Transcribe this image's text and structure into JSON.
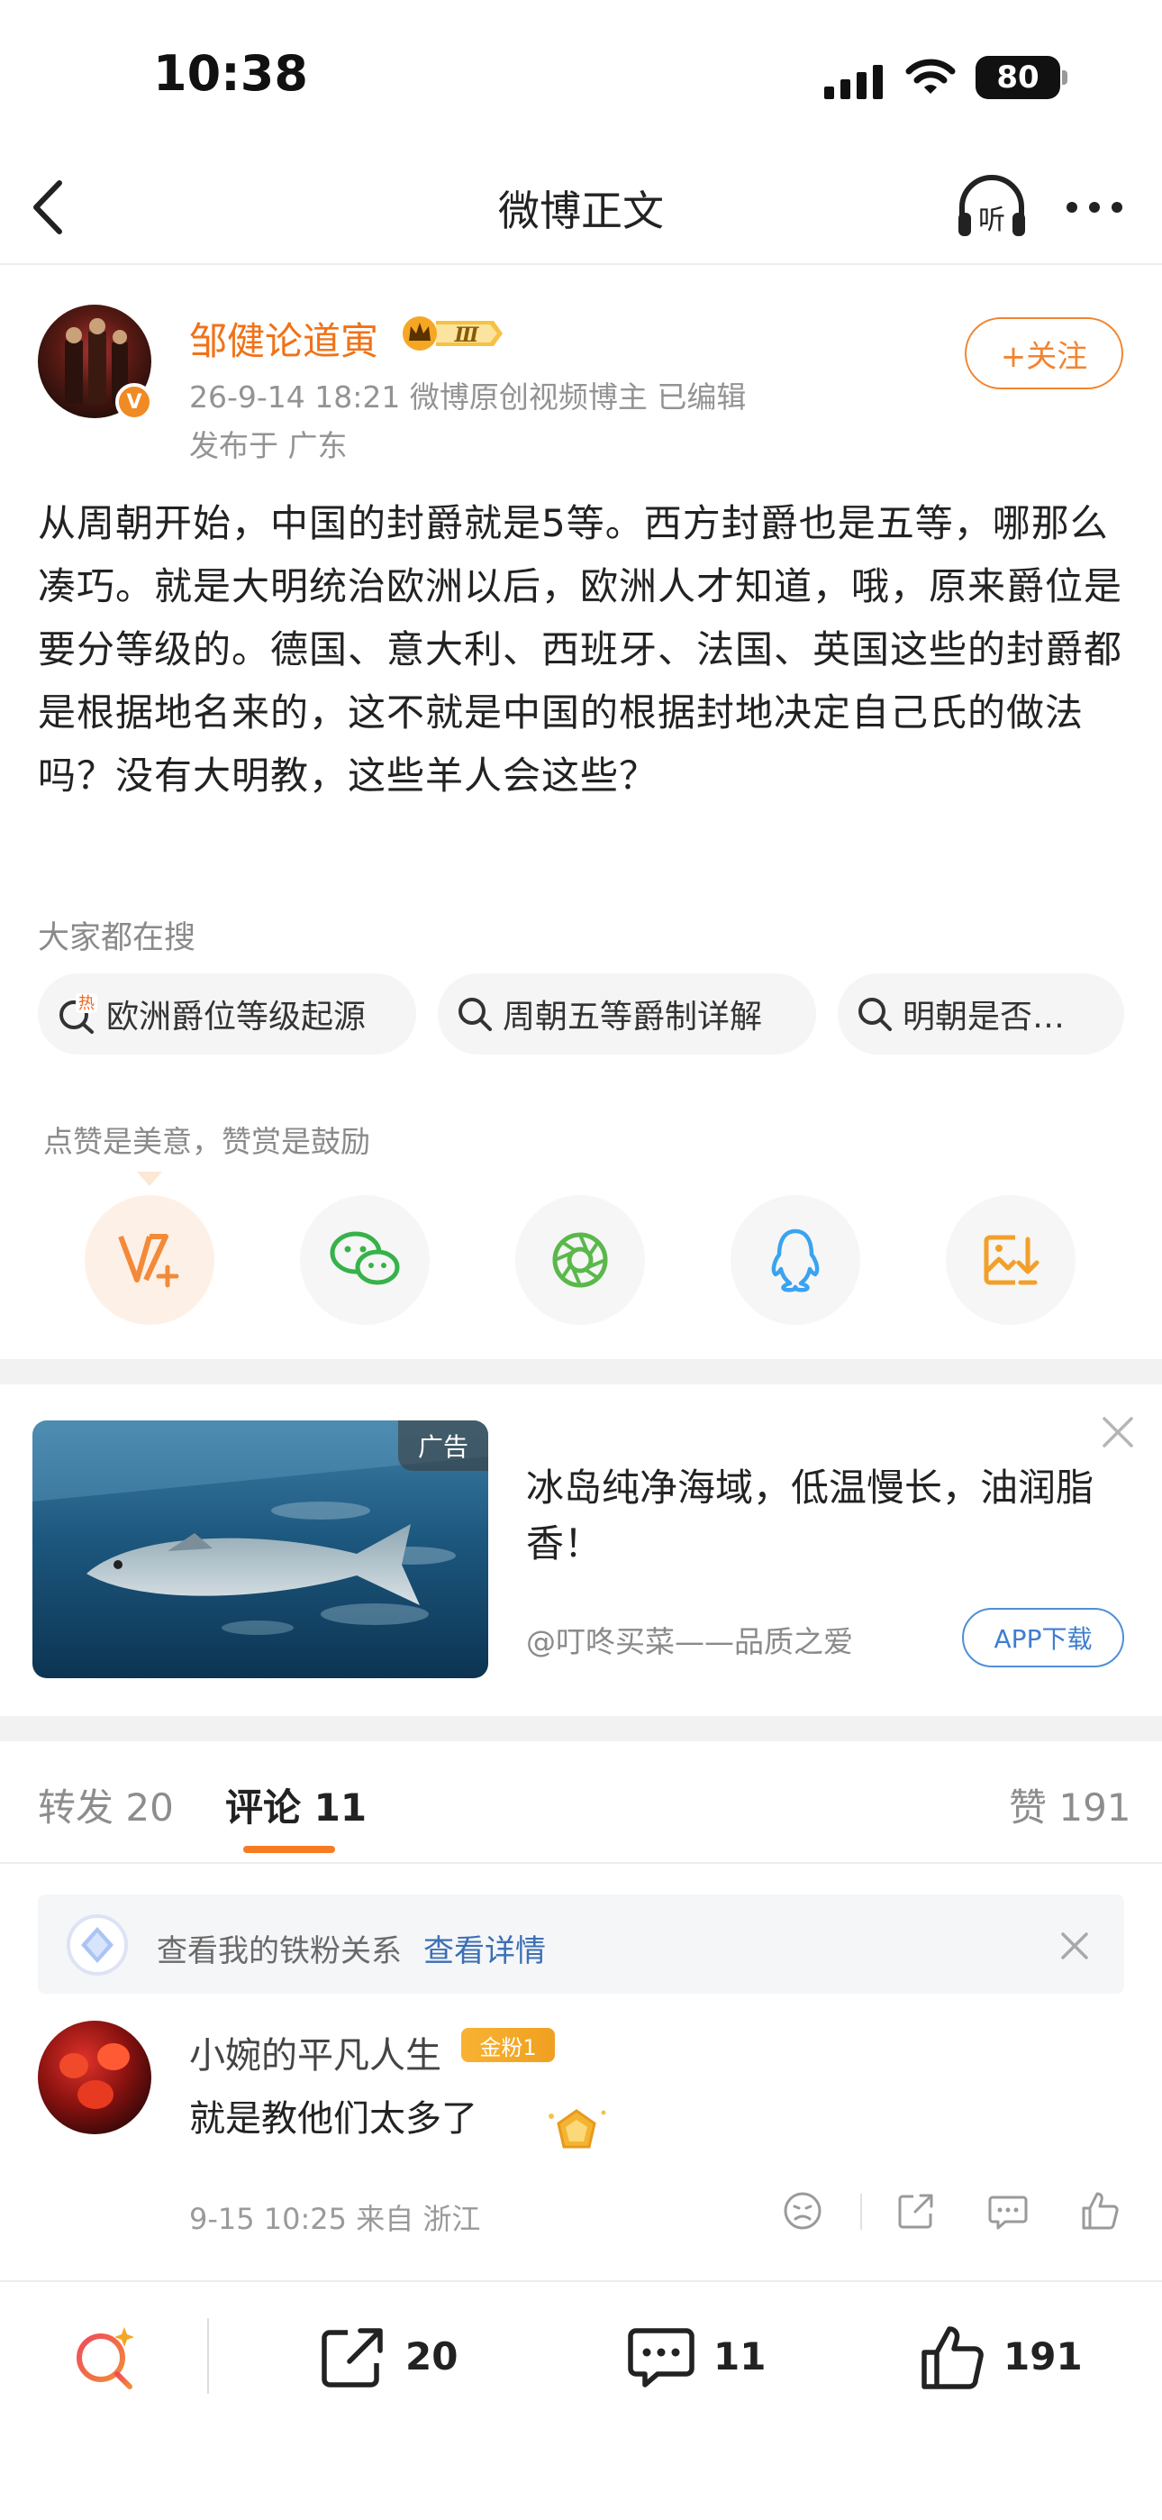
{
  "status_bar": {
    "time": "10:38",
    "battery": "80"
  },
  "nav": {
    "title": "微博正文",
    "listen_icon": "listen-headphones-icon",
    "more_icon": "more-icon"
  },
  "author": {
    "name": "邹健论道寅",
    "vip_icon": "crown-vip-badge-icon",
    "vip_level": "Ⅲ",
    "verified_mark": "V",
    "meta": "26-9-14 18:21  微博原创视频博主  已编辑",
    "location": "发布于 广东",
    "follow_label": "+关注"
  },
  "post": {
    "text": "从周朝开始，中国的封爵就是5等。西方封爵也是五等，哪那么凑巧。就是大明统治欧洲以后，欧洲人才知道，哦，原来爵位是要分等级的。德国、意大利、西班牙、法国、英国这些的封爵都是根据地名来的，这不就是中国的根据封地决定自己氏的做法吗？没有大明教，这些羊人会这些？"
  },
  "search": {
    "title": "大家都在搜",
    "hot_mark": "热",
    "chips": [
      "欧洲爵位等级起源",
      "周朝五等爵制详解",
      "明朝是否…"
    ]
  },
  "reward": {
    "tip": "点赞是美意，赞赏是鼓励"
  },
  "share_buttons": [
    "reward-v-plus-icon",
    "wechat-icon",
    "moments-icon",
    "qq-icon",
    "save-image-icon"
  ],
  "ad": {
    "tag": "广告",
    "title": "冰岛纯净海域，低温慢长，油润脂香！",
    "source": "@叮咚买菜——品质之爱",
    "button": "APP下载"
  },
  "tabs": {
    "repost": "转发 20",
    "comment": "评论 11",
    "like": "赞 191"
  },
  "fan_bar": {
    "text": "查看我的铁粉关系",
    "link": "查看详情"
  },
  "comment": {
    "user": "小婉的平凡人生",
    "badge": "金粉1",
    "text": "就是教他们太多了",
    "meta": "9-15 10:25 来自 浙江"
  },
  "bottom_bar": {
    "repost_count": "20",
    "comment_count": "11",
    "like_count": "191"
  },
  "colors": {
    "accent": "#f07218",
    "link": "#3c6fb5",
    "like_orange": "#f77b23"
  }
}
